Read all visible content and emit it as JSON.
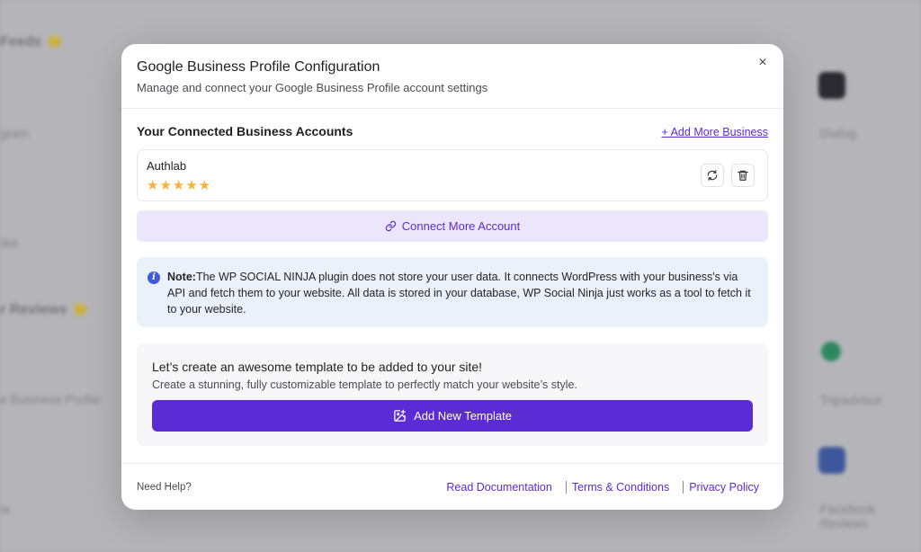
{
  "background": {
    "items": [
      {
        "text": "Feeds ⭐"
      },
      {
        "text": "gram"
      },
      {
        "text": "dot"
      },
      {
        "text": "r Reviews ⭐"
      },
      {
        "text": "e Business Profile"
      },
      {
        "text": "ia"
      },
      {
        "text": "Dialog"
      },
      {
        "text": "Tripadvisor"
      },
      {
        "text": "Facebook Reviews"
      }
    ]
  },
  "modal": {
    "title": "Google Business Profile Configuration",
    "subtitle": "Manage and connect your Google Business Profile account settings",
    "close_icon": "×",
    "section_title": "Your Connected Business Accounts",
    "add_more_label": "+ Add More Business",
    "account": {
      "name": "Authlab",
      "rating": 5,
      "stars": "★★★★★"
    },
    "connect_label": "Connect More Account",
    "note": {
      "label": "Note:",
      "text": "The WP SOCIAL NINJA plugin does not store your user data. It connects WordPress with your business's via API and fetch them to your website. All data is stored in your database, WP Social Ninja just works as a tool to fetch it to your website."
    },
    "template": {
      "title": "Let’s create an awesome template to be added to your site!",
      "description": "Create a stunning, fully customizable template to perfectly match your website’s style.",
      "button_label": "Add New Template"
    },
    "footer": {
      "help_text": "Need Help?",
      "links": [
        "Read Documentation",
        "Terms & Conditions",
        "Privacy Policy"
      ]
    }
  },
  "colors": {
    "accent": "#5b2bd6",
    "star": "#f5b23a",
    "note_bg": "#eaf1fb",
    "connect_bg": "#ece6fb"
  }
}
